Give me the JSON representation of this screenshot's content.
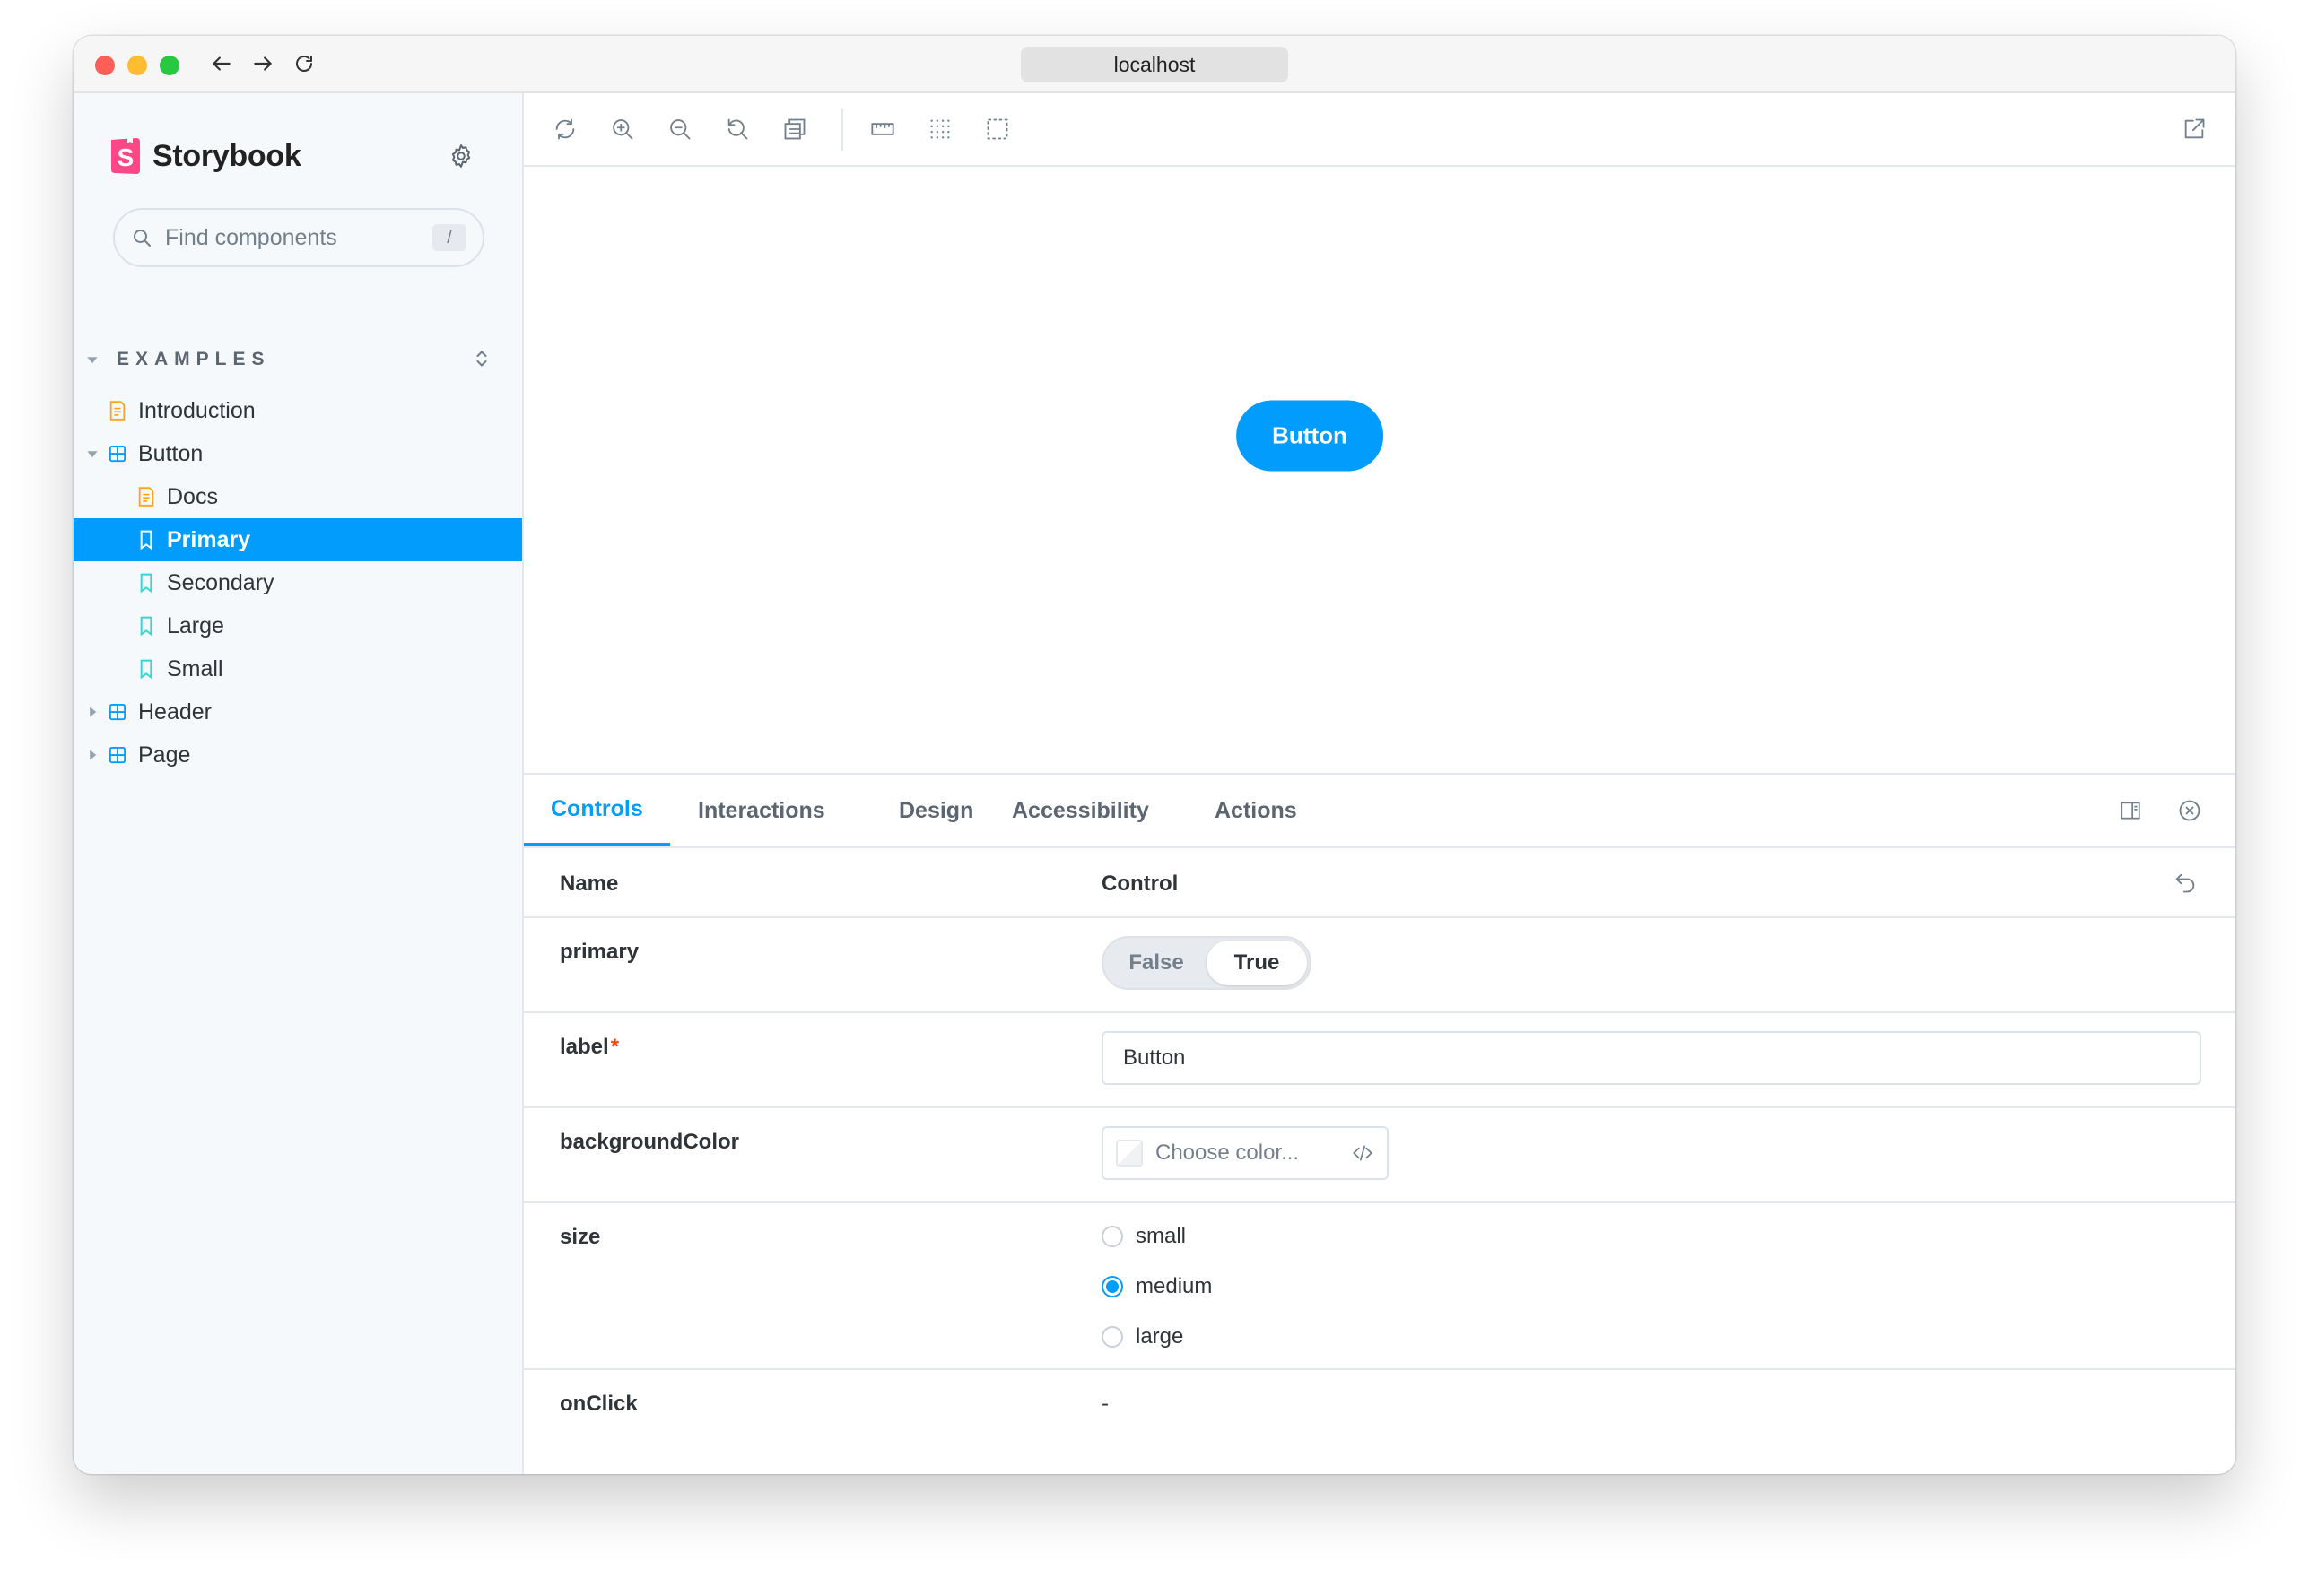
{
  "browser": {
    "url": "localhost"
  },
  "sidebar": {
    "brand": "Storybook",
    "search_placeholder": "Find components",
    "search_shortcut": "/",
    "group_label": "EXAMPLES",
    "items": [
      {
        "label": "Introduction",
        "type": "doc"
      },
      {
        "label": "Button",
        "type": "component"
      },
      {
        "label": "Docs",
        "type": "doc"
      },
      {
        "label": "Primary",
        "type": "story"
      },
      {
        "label": "Secondary",
        "type": "story"
      },
      {
        "label": "Large",
        "type": "story"
      },
      {
        "label": "Small",
        "type": "story"
      },
      {
        "label": "Header",
        "type": "component"
      },
      {
        "label": "Page",
        "type": "component"
      }
    ]
  },
  "preview": {
    "button_label": "Button"
  },
  "panel": {
    "tabs": [
      "Controls",
      "Interactions",
      "Design",
      "Accessibility",
      "Actions"
    ],
    "active_tab": "Controls",
    "header_name": "Name",
    "header_control": "Control",
    "rows": {
      "primary": {
        "name": "primary",
        "false_label": "False",
        "true_label": "True",
        "value": "True"
      },
      "label": {
        "name": "label",
        "required_mark": "*",
        "value": "Button"
      },
      "background": {
        "name": "backgroundColor",
        "placeholder": "Choose color..."
      },
      "size": {
        "name": "size",
        "options": [
          "small",
          "medium",
          "large"
        ],
        "selected": "medium"
      },
      "onclick": {
        "name": "onClick",
        "value": "-"
      }
    }
  },
  "colors": {
    "accent": "#029cfd",
    "brand_pink": "#ff4785",
    "doc_icon": "#f5a623",
    "story_icon": "#37d5d3",
    "component_icon": "#029cfd"
  },
  "icons": {
    "sync": "sync-icon",
    "zoom_in": "zoom-in-icon",
    "zoom_out": "zoom-out-icon",
    "zoom_reset": "zoom-reset-icon",
    "background": "background-icon",
    "ruler": "measure-icon",
    "grid": "grid-icon",
    "outline": "outline-icon",
    "open_new": "open-new-window-icon"
  }
}
